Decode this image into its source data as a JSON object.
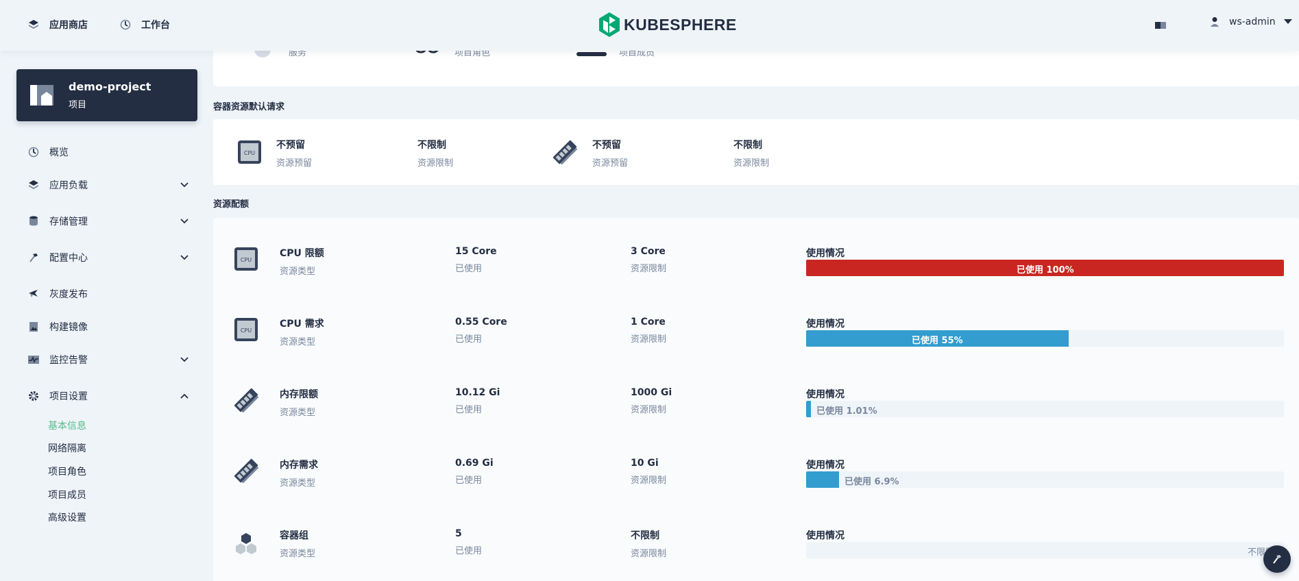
{
  "topbar": {
    "app_store": "应用商店",
    "workbench": "工作台",
    "brand": "KUBESPHERE",
    "username": "ws-admin"
  },
  "project": {
    "name": "demo-project",
    "type": "项目"
  },
  "sidebar": {
    "items": [
      {
        "label": "概览",
        "icon": "dashboard-icon"
      },
      {
        "label": "应用负载",
        "icon": "appcenter-icon"
      },
      {
        "label": "存储管理",
        "icon": "storage-icon"
      },
      {
        "label": "配置中心",
        "icon": "hammer-icon"
      },
      {
        "label": "灰度发布",
        "icon": "bird-icon"
      },
      {
        "label": "构建镜像",
        "icon": "image-icon"
      },
      {
        "label": "监控告警",
        "icon": "monitor-icon"
      },
      {
        "label": "项目设置",
        "icon": "gear-icon"
      }
    ],
    "sub_items": [
      "基本信息",
      "网络隔离",
      "项目角色",
      "项目成员",
      "高级设置"
    ],
    "active_sub": "基本信息"
  },
  "top_partial": {
    "labels": [
      "服务",
      "项目角色",
      "项目成员"
    ]
  },
  "default_request": {
    "title": "容器资源默认请求",
    "items": [
      {
        "value": "不预留",
        "label": "资源预留"
      },
      {
        "value": "不限制",
        "label": "资源限制"
      },
      {
        "value": "不预留",
        "label": "资源预留"
      },
      {
        "value": "不限制",
        "label": "资源限制"
      }
    ]
  },
  "quota": {
    "title": "资源配额",
    "type_label": "资源类型",
    "used_label": "已使用",
    "limit_label": "资源限制",
    "usage_label": "使用情况",
    "rows": [
      {
        "name": "CPU 限额",
        "used": "15 Core",
        "limit": "3 Core",
        "usage_text": "已使用 100%",
        "percent": 100,
        "color": "#ca2621",
        "icon": "cpu-icon"
      },
      {
        "name": "CPU 需求",
        "used": "0.55 Core",
        "limit": "1 Core",
        "usage_text": "已使用 55%",
        "percent": 55,
        "color": "#329dce",
        "icon": "cpu-icon"
      },
      {
        "name": "内存限额",
        "used": "10.12 Gi",
        "limit": "1000 Gi",
        "usage_text": "已使用 1.01%",
        "percent": 1.01,
        "color": "#329dce",
        "icon": "memory-icon"
      },
      {
        "name": "内存需求",
        "used": "0.69 Gi",
        "limit": "10 Gi",
        "usage_text": "已使用 6.9%",
        "percent": 6.9,
        "color": "#329dce",
        "icon": "memory-icon"
      },
      {
        "name": "容器组",
        "used": "5",
        "limit": "不限制",
        "usage_text": "不限制",
        "percent": 0,
        "color": "#329dce",
        "icon": "pod-icon"
      }
    ]
  },
  "colors": {
    "background": "#eff4f9",
    "dark": "#242e42",
    "accent_green": "#55bc8a",
    "danger": "#ca2621",
    "info": "#329dce"
  }
}
